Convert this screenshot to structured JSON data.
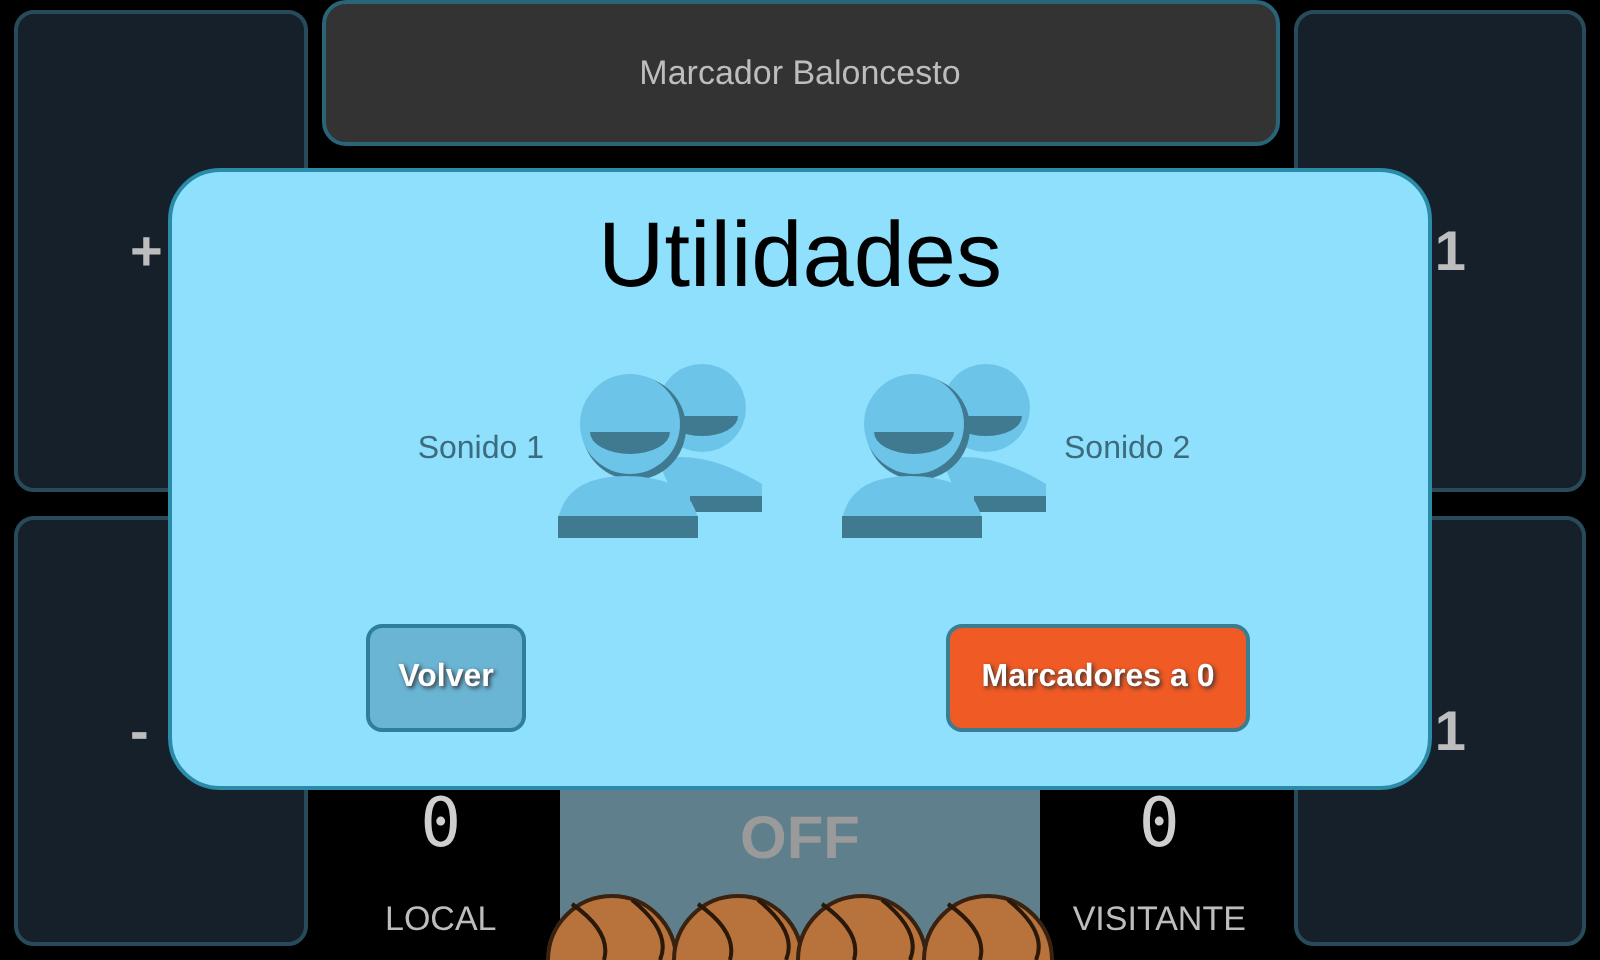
{
  "header": {
    "title": "Marcador Baloncesto"
  },
  "panels": [
    {
      "label": "+"
    },
    {
      "label": "1"
    },
    {
      "label": "-"
    },
    {
      "label": "1"
    }
  ],
  "scoreboard": {
    "local": {
      "score": "0",
      "name": "LOCAL"
    },
    "clock": "OFF",
    "visitor": {
      "score": "0",
      "name": "VISITANTE"
    }
  },
  "dialog": {
    "title": "Utilidades",
    "sounds": [
      {
        "label": "Sonido 1"
      },
      {
        "label": "Sonido 2"
      }
    ],
    "buttons": [
      {
        "label": "Volver",
        "kind": "secondary"
      },
      {
        "label": "Marcadores a 0",
        "kind": "primary"
      }
    ]
  }
}
